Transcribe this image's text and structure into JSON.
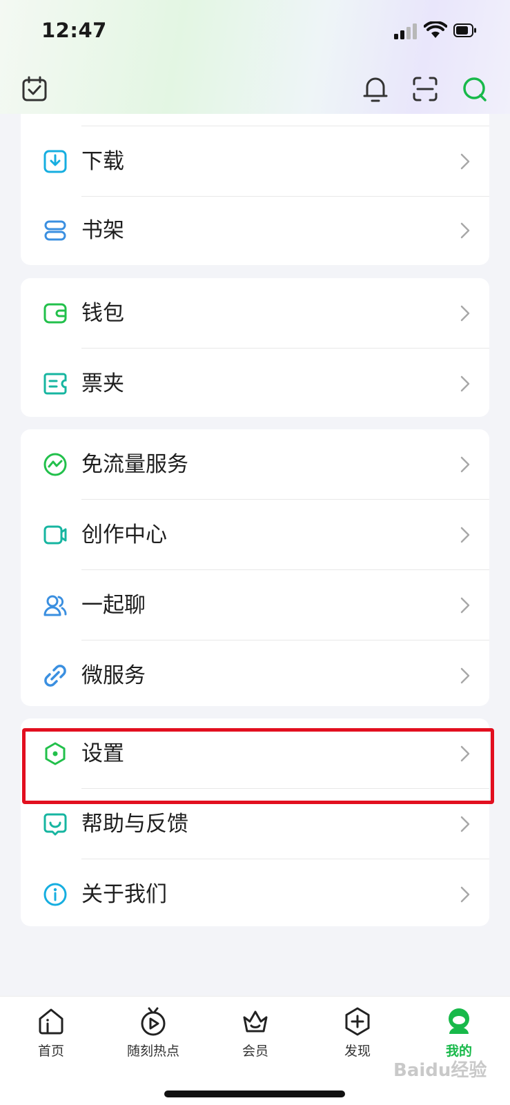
{
  "status_bar": {
    "time": "12:47"
  },
  "header": {
    "icons": [
      "calendar-check-icon",
      "bell-icon",
      "scan-icon",
      "search-icon"
    ]
  },
  "groups": [
    {
      "items": [
        {
          "label": "下载",
          "icon": "download-icon"
        },
        {
          "label": "书架",
          "icon": "bookshelf-icon"
        }
      ]
    },
    {
      "items": [
        {
          "label": "钱包",
          "icon": "wallet-icon"
        },
        {
          "label": "票夹",
          "icon": "ticket-icon"
        }
      ]
    },
    {
      "items": [
        {
          "label": "免流量服务",
          "icon": "traffic-free-icon"
        },
        {
          "label": "创作中心",
          "icon": "video-camera-icon"
        },
        {
          "label": "一起聊",
          "icon": "users-icon"
        },
        {
          "label": "微服务",
          "icon": "link-icon"
        }
      ]
    },
    {
      "items": [
        {
          "label": "设置",
          "icon": "settings-hexagon-icon"
        },
        {
          "label": "帮助与反馈",
          "icon": "feedback-icon"
        },
        {
          "label": "关于我们",
          "icon": "info-icon"
        }
      ]
    }
  ],
  "tabs": [
    {
      "label": "首页",
      "icon": "home-icon"
    },
    {
      "label": "随刻热点",
      "icon": "play-hot-icon"
    },
    {
      "label": "会员",
      "icon": "vip-basket-icon"
    },
    {
      "label": "发现",
      "icon": "discover-plus-icon"
    },
    {
      "label": "我的",
      "icon": "profile-avatar-icon",
      "active": true
    }
  ],
  "watermark": "Baidu经验",
  "colors": {
    "accent_green": "#18b94a",
    "teal": "#16b5b0",
    "blue": "#3a8fe0",
    "highlight_red": "#e20f1f"
  }
}
